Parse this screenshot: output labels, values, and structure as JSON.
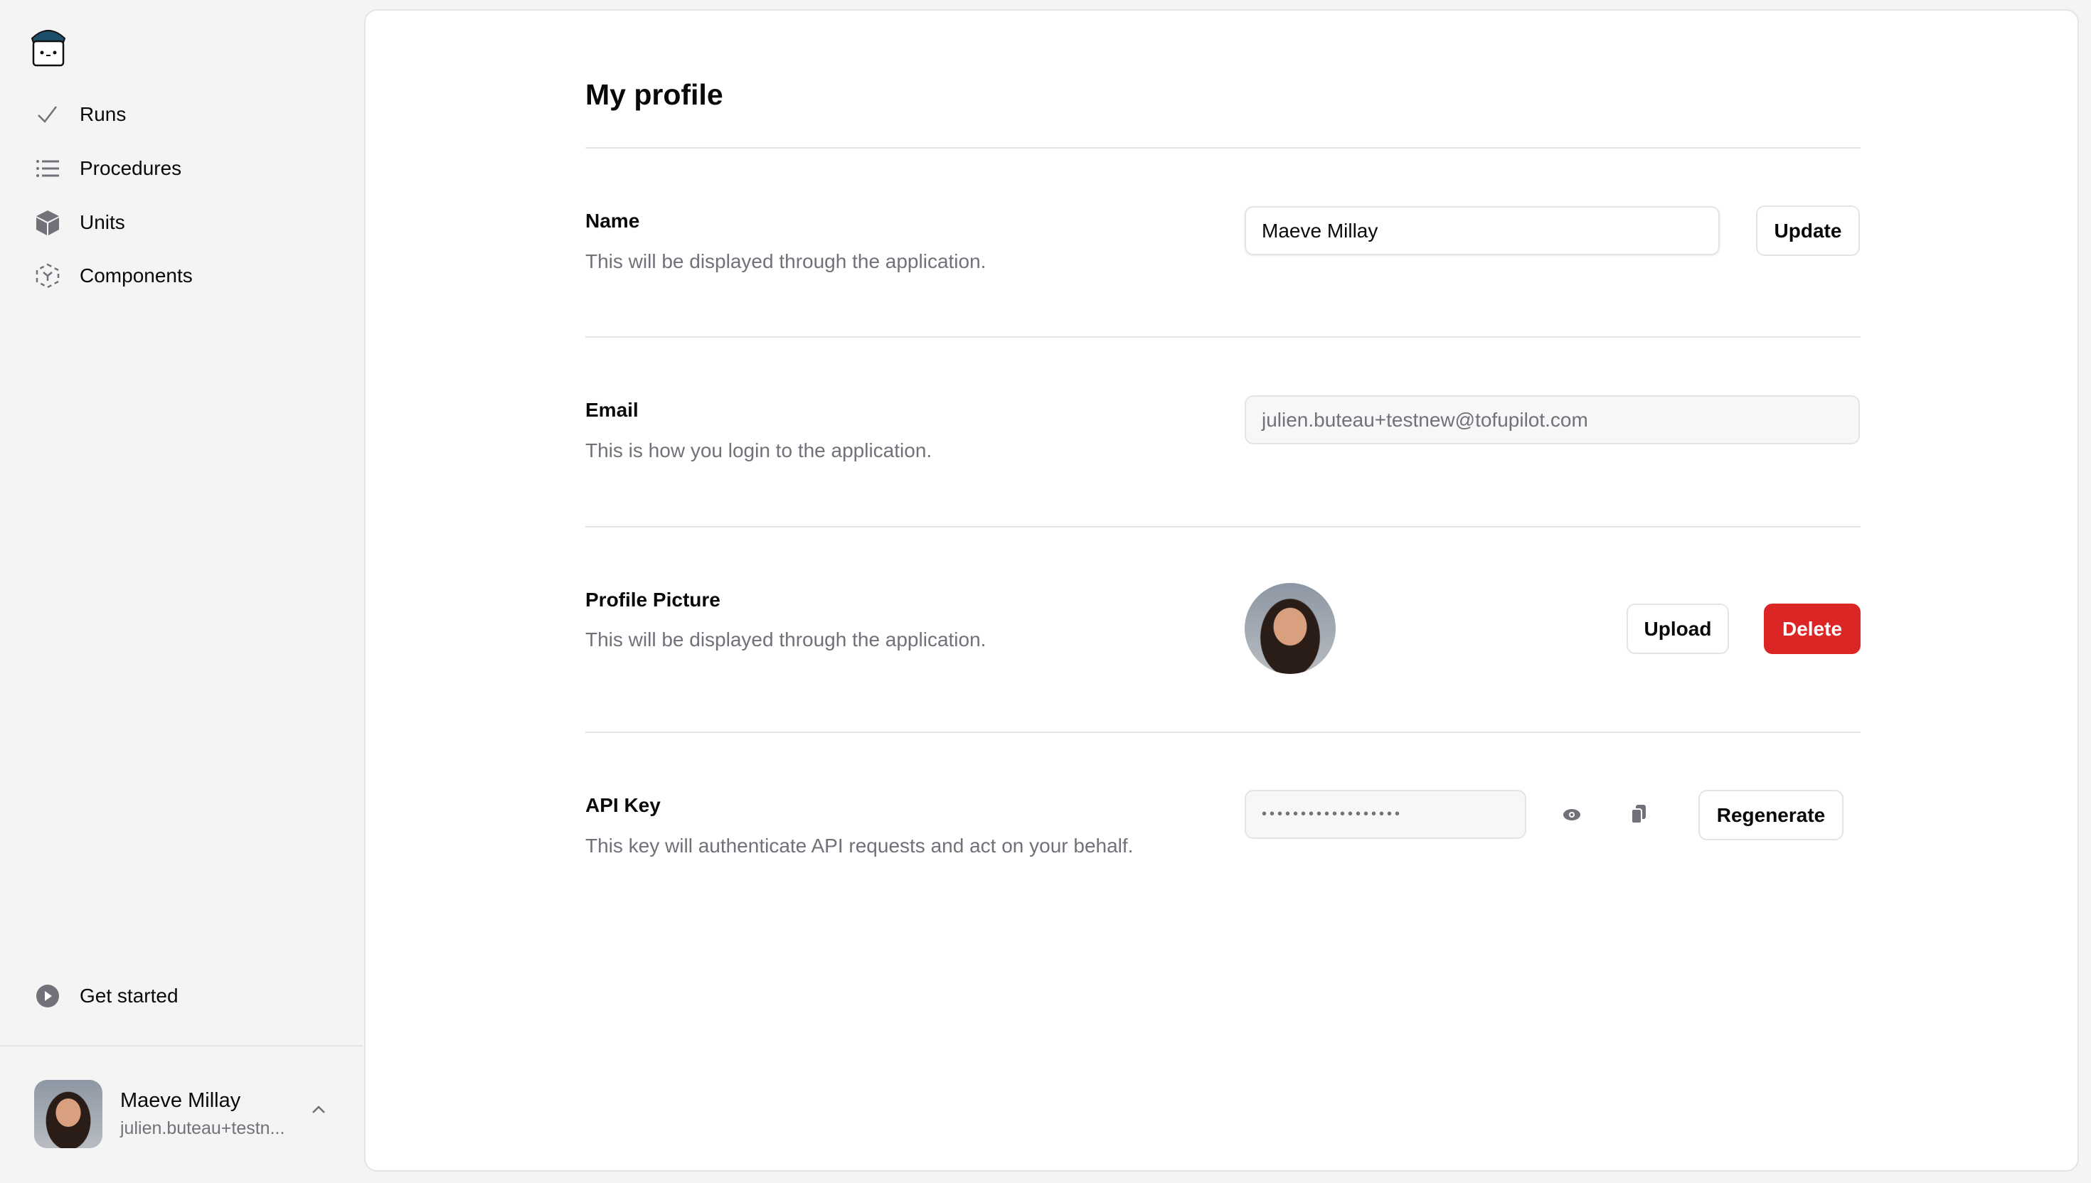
{
  "sidebar": {
    "logo": "tofupilot-logo",
    "items": [
      {
        "label": "Runs",
        "icon": "check-icon"
      },
      {
        "label": "Procedures",
        "icon": "list-icon"
      },
      {
        "label": "Units",
        "icon": "cube-icon"
      },
      {
        "label": "Components",
        "icon": "components-icon"
      }
    ],
    "get_started": {
      "label": "Get started",
      "icon": "play-circle-icon"
    },
    "user": {
      "name": "Maeve Millay",
      "email": "julien.buteau+testn..."
    }
  },
  "main": {
    "title": "My profile",
    "name": {
      "label": "Name",
      "description": "This will be displayed through the application.",
      "value": "Maeve Millay",
      "button": "Update"
    },
    "email": {
      "label": "Email",
      "description": "This is how you login to the application.",
      "value": "julien.buteau+testnew@tofupilot.com"
    },
    "picture": {
      "label": "Profile Picture",
      "description": "This will be displayed through the application.",
      "upload": "Upload",
      "delete": "Delete"
    },
    "api": {
      "label": "API Key",
      "description": "This key will authenticate API requests and act on your behalf.",
      "masked": "••••••••••••••••••",
      "button": "Regenerate"
    }
  },
  "colors": {
    "danger": "#dc2626",
    "icon": "#71717a"
  }
}
